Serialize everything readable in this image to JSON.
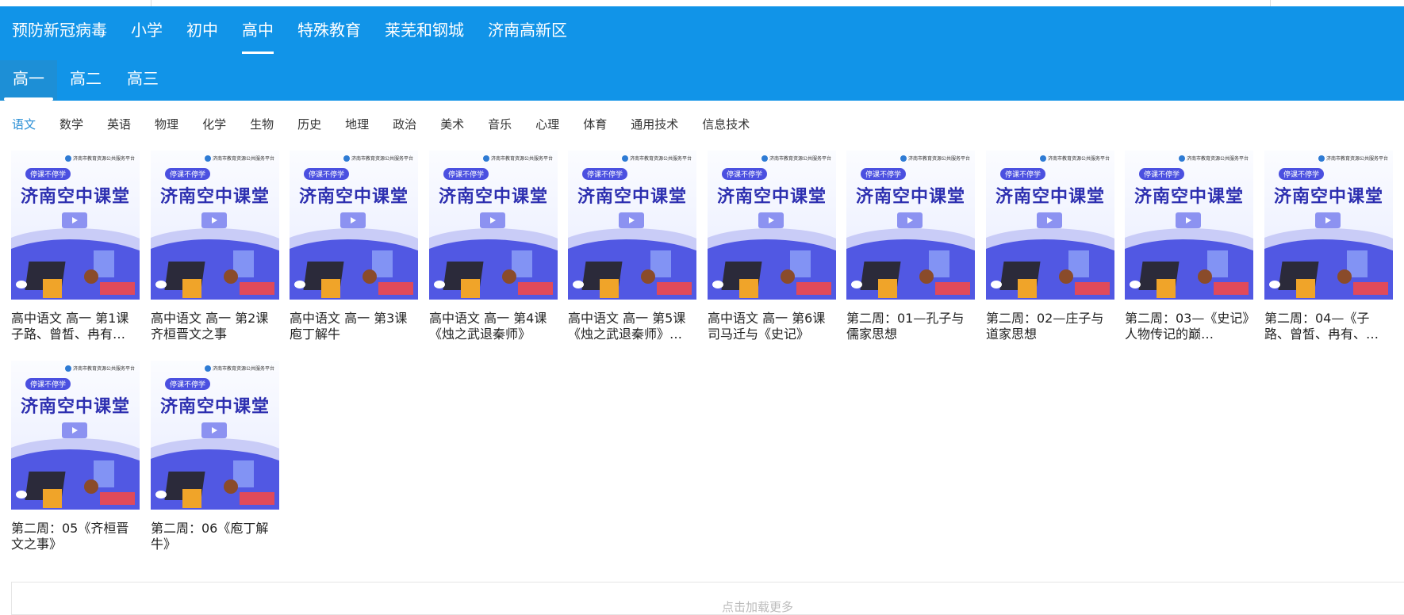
{
  "nav_primary": [
    {
      "label": "预防新冠病毒",
      "active": false
    },
    {
      "label": "小学",
      "active": false
    },
    {
      "label": "初中",
      "active": false
    },
    {
      "label": "高中",
      "active": true
    },
    {
      "label": "特殊教育",
      "active": false
    },
    {
      "label": "莱芜和钢城",
      "active": false
    },
    {
      "label": "济南高新区",
      "active": false
    }
  ],
  "nav_grade": [
    {
      "label": "高一",
      "active": true
    },
    {
      "label": "高二",
      "active": false
    },
    {
      "label": "高三",
      "active": false
    }
  ],
  "subjects": [
    {
      "label": "语文",
      "active": true
    },
    {
      "label": "数学",
      "active": false
    },
    {
      "label": "英语",
      "active": false
    },
    {
      "label": "物理",
      "active": false
    },
    {
      "label": "化学",
      "active": false
    },
    {
      "label": "生物",
      "active": false
    },
    {
      "label": "历史",
      "active": false
    },
    {
      "label": "地理",
      "active": false
    },
    {
      "label": "政治",
      "active": false
    },
    {
      "label": "美术",
      "active": false
    },
    {
      "label": "音乐",
      "active": false
    },
    {
      "label": "心理",
      "active": false
    },
    {
      "label": "体育",
      "active": false
    },
    {
      "label": "通用技术",
      "active": false
    },
    {
      "label": "信息技术",
      "active": false
    }
  ],
  "thumbnail": {
    "badge": "停课不停学",
    "title": "济南空中课堂",
    "org": "济南市教育资源公共服务平台"
  },
  "videos": [
    {
      "caption": "高中语文 高一 第1课 子路、曾皙、冉有…"
    },
    {
      "caption": "高中语文 高一 第2课 齐桓晋文之事"
    },
    {
      "caption": "高中语文 高一 第3课 庖丁解牛"
    },
    {
      "caption": "高中语文 高一 第4课 《烛之武退秦师》"
    },
    {
      "caption": "高中语文 高一 第5课 《烛之武退秦师》…"
    },
    {
      "caption": "高中语文 高一 第6课 司马迁与《史记》"
    },
    {
      "caption": "第二周：01—孔子与儒家思想"
    },
    {
      "caption": "第二周：02—庄子与道家思想"
    },
    {
      "caption": "第二周：03—《史记》人物传记的巅…"
    },
    {
      "caption": "第二周：04—《子路、曾皙、冉有、…"
    },
    {
      "caption": "第二周：05《齐桓晋文之事》"
    },
    {
      "caption": "第二周：06《庖丁解牛》"
    }
  ],
  "load_more": "点击加载更多"
}
